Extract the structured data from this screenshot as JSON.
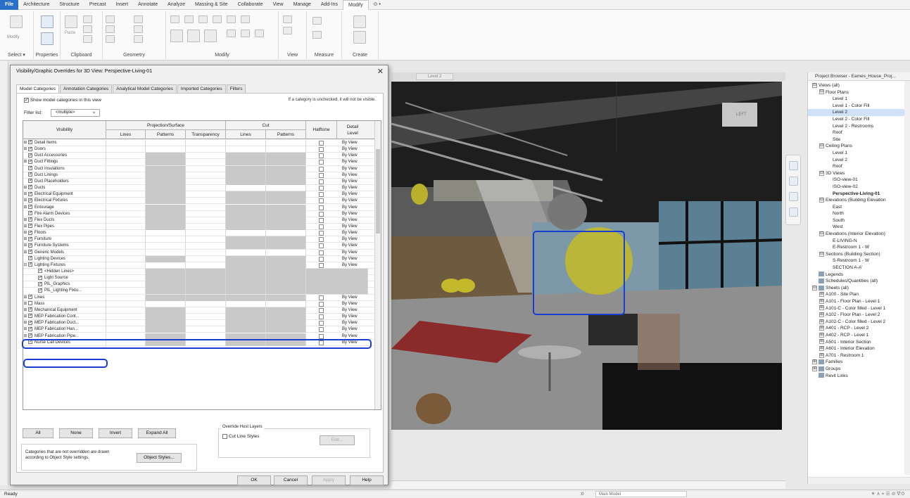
{
  "menubar": {
    "items": [
      "File",
      "Architecture",
      "Structure",
      "Precast",
      "Insert",
      "Annotate",
      "Analyze",
      "Massing & Site",
      "Collaborate",
      "View",
      "Manage",
      "Add-Ins",
      "Modify",
      "⊙ •"
    ]
  },
  "ribbon": {
    "groups": [
      "Select ▾",
      "Properties",
      "Clipboard",
      "Geometry",
      "Modify",
      "View",
      "Measure",
      "Create"
    ],
    "modify_label": "Modify",
    "paste_label": "Paste"
  },
  "dialog": {
    "title": "Visibility/Graphic Overrides for 3D View: Perspective-Living-01",
    "close": "✕",
    "tabs": [
      "Model Categories",
      "Annotation Categories",
      "Analytical Model Categories",
      "Imported Categories",
      "Filters"
    ],
    "show_label": "Show model categories in this view",
    "hint": "If a category is unchecked, it will not be visible.",
    "filter_label": "Filter list:",
    "filter_value": "<multiple>",
    "columns": {
      "visibility": "Visibility",
      "projection": "Projection/Surface",
      "lines": "Lines",
      "patterns": "Patterns",
      "transparency": "Transparency",
      "cut": "Cut",
      "cut_lines": "Lines",
      "cut_patterns": "Patterns",
      "halftone": "Halftone",
      "detail": "Detail Level"
    },
    "rows": [
      {
        "name": "Detail Items",
        "exp": "⊞",
        "checked": true,
        "detail": "By View"
      },
      {
        "name": "Doors",
        "exp": "⊞",
        "checked": true,
        "detail": "By View"
      },
      {
        "name": "Duct Accessories",
        "exp": "",
        "checked": true,
        "detail": "By View"
      },
      {
        "name": "Duct Fittings",
        "exp": "⊞",
        "checked": true,
        "detail": "By View"
      },
      {
        "name": "Duct Insulations",
        "exp": "",
        "checked": true,
        "detail": "By View"
      },
      {
        "name": "Duct Linings",
        "exp": "",
        "checked": true,
        "detail": "By View"
      },
      {
        "name": "Duct Placeholders",
        "exp": "",
        "checked": true,
        "detail": "By View"
      },
      {
        "name": "Ducts",
        "exp": "⊞",
        "checked": true,
        "detail": "By View"
      },
      {
        "name": "Electrical Equipment",
        "exp": "⊞",
        "checked": true,
        "detail": "By View"
      },
      {
        "name": "Electrical Fixtures",
        "exp": "⊞",
        "checked": true,
        "detail": "By View"
      },
      {
        "name": "Entourage",
        "exp": "⊞",
        "checked": true,
        "detail": "By View"
      },
      {
        "name": "Fire Alarm Devices",
        "exp": "",
        "checked": true,
        "detail": "By View"
      },
      {
        "name": "Flex Ducts",
        "exp": "⊞",
        "checked": true,
        "detail": "By View"
      },
      {
        "name": "Flex Pipes",
        "exp": "⊞",
        "checked": true,
        "detail": "By View"
      },
      {
        "name": "Floors",
        "exp": "⊞",
        "checked": true,
        "detail": "By View"
      },
      {
        "name": "Furniture",
        "exp": "⊞",
        "checked": true,
        "detail": "By View"
      },
      {
        "name": "Furniture Systems",
        "exp": "⊞",
        "checked": true,
        "detail": "By View"
      },
      {
        "name": "Generic Models",
        "exp": "⊞",
        "checked": true,
        "detail": "By View"
      },
      {
        "name": "Lighting Devices",
        "exp": "",
        "checked": true,
        "detail": "By View"
      },
      {
        "name": "Lighting Fixtures",
        "exp": "⊟",
        "checked": true,
        "detail": "By View"
      },
      {
        "name": "<Hidden Lines>",
        "exp": "",
        "checked": true,
        "detail": "",
        "child": true
      },
      {
        "name": "Light Source",
        "exp": "",
        "checked": true,
        "detail": "",
        "child": true
      },
      {
        "name": "PIL_Graphics",
        "exp": "",
        "checked": true,
        "detail": "",
        "child": true
      },
      {
        "name": "PIL_Lighting Fixtu...",
        "exp": "",
        "checked": true,
        "detail": "",
        "child": true
      },
      {
        "name": "Lines",
        "exp": "⊞",
        "checked": true,
        "detail": "By View"
      },
      {
        "name": "Mass",
        "exp": "⊞",
        "checked": false,
        "detail": "By View"
      },
      {
        "name": "Mechanical Equipment",
        "exp": "⊞",
        "checked": true,
        "detail": "By View"
      },
      {
        "name": "MEP Fabrication Cont...",
        "exp": "⊞",
        "checked": true,
        "detail": "By View"
      },
      {
        "name": "MEP Fabrication Duct...",
        "exp": "⊞",
        "checked": true,
        "detail": "By View"
      },
      {
        "name": "MEP Fabrication Han...",
        "exp": "⊞",
        "checked": true,
        "detail": "By View"
      },
      {
        "name": "MEP Fabrication Pipe...",
        "exp": "⊞",
        "checked": true,
        "detail": "By View"
      },
      {
        "name": "Nurse Call Devices",
        "exp": "",
        "checked": true,
        "detail": "By View"
      }
    ],
    "buttons": {
      "all": "All",
      "none": "None",
      "invert": "Invert",
      "expand_all": "Expand All",
      "override_host": "Override Host Layers",
      "cut_line_styles": "Cut Line Styles",
      "edit": "Edit...",
      "object_styles": "Object Styles...",
      "ok": "OK",
      "cancel": "Cancel",
      "apply": "Apply",
      "help": "Help"
    },
    "note": "Categories that are not overridden are drawn according to Object Style settings."
  },
  "viewport": {
    "tab_label": "Level 2",
    "viewcube_label": "LEFT"
  },
  "project_browser": {
    "title": "Project Browser - Eames_House_Proj...",
    "nodes": [
      {
        "label": "Views (all)",
        "level": 0,
        "tg": "⊟"
      },
      {
        "label": "Floor Plans",
        "level": 1,
        "tg": "⊟"
      },
      {
        "label": "Level 1",
        "level": 2
      },
      {
        "label": "Level 1 - Color Fill",
        "level": 2
      },
      {
        "label": "Level 2",
        "level": 2,
        "sel": true
      },
      {
        "label": "Level 2 - Color Fill",
        "level": 2
      },
      {
        "label": "Level 2 - Restrooms",
        "level": 2
      },
      {
        "label": "Roof",
        "level": 2
      },
      {
        "label": "Site",
        "level": 2
      },
      {
        "label": "Ceiling Plans",
        "level": 1,
        "tg": "⊟"
      },
      {
        "label": "Level 1",
        "level": 2
      },
      {
        "label": "Level 2",
        "level": 2
      },
      {
        "label": "Roof",
        "level": 2
      },
      {
        "label": "3D Views",
        "level": 1,
        "tg": "⊟"
      },
      {
        "label": "ISO-view-01",
        "level": 2
      },
      {
        "label": "ISO-view-02",
        "level": 2
      },
      {
        "label": "Perspective-Living-01",
        "level": 2,
        "bold": true
      },
      {
        "label": "Elevations (Building Elevation",
        "level": 1,
        "tg": "⊟"
      },
      {
        "label": "East",
        "level": 2
      },
      {
        "label": "North",
        "level": 2
      },
      {
        "label": "South",
        "level": 2
      },
      {
        "label": "West",
        "level": 2
      },
      {
        "label": "Elevations (Interior Elevation)",
        "level": 1,
        "tg": "⊟"
      },
      {
        "label": "E-LIVING-N",
        "level": 2
      },
      {
        "label": "E-Restroom 1 - W",
        "level": 2
      },
      {
        "label": "Sections (Building Section)",
        "level": 1,
        "tg": "⊟"
      },
      {
        "label": "S-Restroom 1 - W",
        "level": 2
      },
      {
        "label": "SECTION A-A'",
        "level": 2
      },
      {
        "label": "Legends",
        "level": 0,
        "icon": true
      },
      {
        "label": "Schedules/Quantities (all)",
        "level": 0,
        "icon": true
      },
      {
        "label": "Sheets (all)",
        "level": 0,
        "tg": "⊟",
        "icon": true
      },
      {
        "label": "A100 - Site Plan",
        "level": 1,
        "tg": "⊞"
      },
      {
        "label": "A101 - Floor Plan - Level 1",
        "level": 1,
        "tg": "⊞"
      },
      {
        "label": "A101-C - Color filled - Level 1",
        "level": 1,
        "tg": "⊞"
      },
      {
        "label": "A102 - Floor Plan - Level 2",
        "level": 1,
        "tg": "⊞"
      },
      {
        "label": "A102-C - Color filled - Level 2",
        "level": 1,
        "tg": "⊞"
      },
      {
        "label": "A401 - RCP - Level 2",
        "level": 1,
        "tg": "⊞"
      },
      {
        "label": "A402 - RCP - Level 1",
        "level": 1,
        "tg": "⊞"
      },
      {
        "label": "A501 - Interior Section",
        "level": 1,
        "tg": "⊞"
      },
      {
        "label": "A601 - Interior Elevation",
        "level": 1,
        "tg": "⊞"
      },
      {
        "label": "A701 - Restroom 1",
        "level": 1,
        "tg": "⊞"
      },
      {
        "label": "Families",
        "level": 0,
        "tg": "⊞",
        "icon": true
      },
      {
        "label": "Groups",
        "level": 0,
        "tg": "⊞",
        "icon": true
      },
      {
        "label": "Revit Links",
        "level": 0,
        "icon": true
      }
    ]
  },
  "statusbar": {
    "ready": "Ready",
    "model": "Main Model",
    "zero": ":0",
    "right": "✶ ∧ ⌖ ☰ ⊘ ∇:0"
  },
  "colors": {
    "highlight": "#1a3fd0",
    "file_tab": "#2a6fc9",
    "override_gray": "#c9c9c9"
  }
}
